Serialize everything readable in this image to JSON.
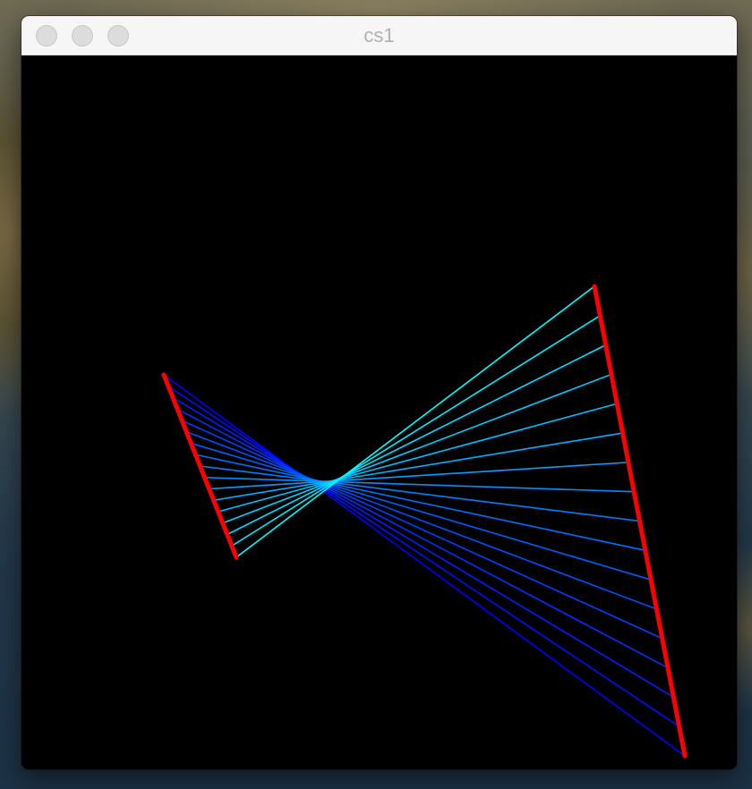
{
  "window": {
    "title": "cs1"
  },
  "colors": {
    "canvas_background": "#000000",
    "edge_lines": "#ff0000",
    "ray_start": "#0000ff",
    "ray_end": "#00ffff",
    "titlebar": "#f6f6f6",
    "title_text": "#b1b1b1"
  },
  "scene": {
    "description_type": "line-string art",
    "left_segment": {
      "color": "red"
    },
    "right_segment": {
      "color": "red"
    },
    "ray_count": 17,
    "ray_gradient": [
      "blue",
      "cyan"
    ]
  }
}
